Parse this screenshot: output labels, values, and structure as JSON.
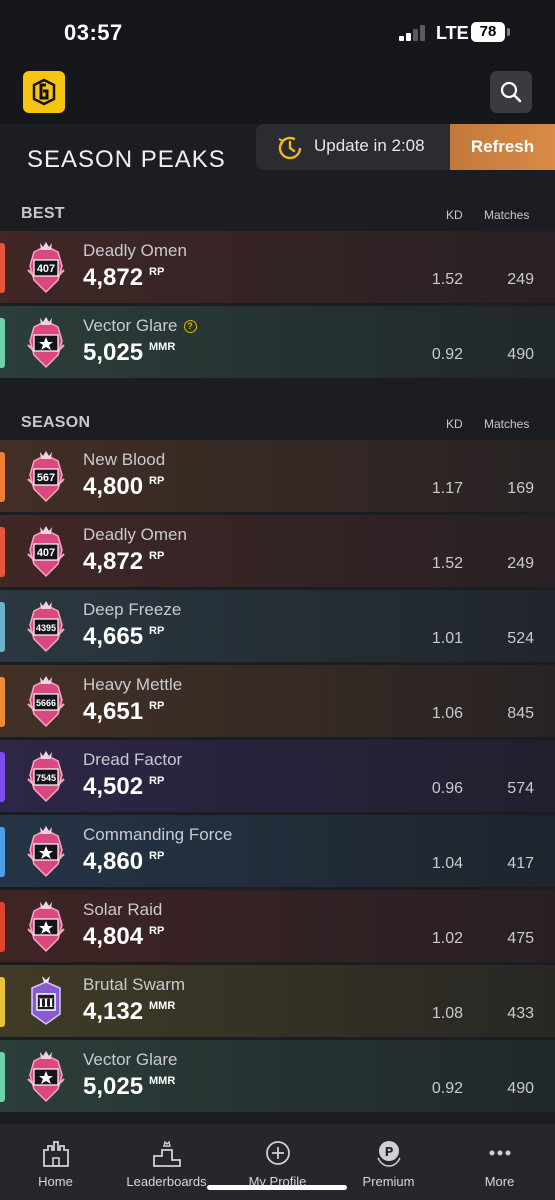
{
  "status_bar": {
    "time": "03:57",
    "network": "LTE",
    "battery": "78"
  },
  "header": {
    "logo_icon": "siege-logo-icon",
    "search_icon": "search-icon"
  },
  "update": {
    "text": "Update in 2:08",
    "refresh_label": "Refresh"
  },
  "page_title": "SEASON PEAKS",
  "columns": {
    "kd": "KD",
    "matches": "Matches"
  },
  "best": {
    "label": "BEST",
    "rows": [
      {
        "name": "Deadly Omen",
        "value": "4,872",
        "unit": "RP",
        "kd": "1.52",
        "matches": "249",
        "badge": "407",
        "accent": "#e8553a",
        "help": false
      },
      {
        "name": "Vector Glare",
        "value": "5,025",
        "unit": "MMR",
        "kd": "0.92",
        "matches": "490",
        "badge": "",
        "accent": "#6fd3a8",
        "help": true
      }
    ]
  },
  "season": {
    "label": "SEASON",
    "rows": [
      {
        "name": "New Blood",
        "value": "4,800",
        "unit": "RP",
        "kd": "1.17",
        "matches": "169",
        "badge": "567",
        "accent": "#ef7d35"
      },
      {
        "name": "Deadly Omen",
        "value": "4,872",
        "unit": "RP",
        "kd": "1.52",
        "matches": "249",
        "badge": "407",
        "accent": "#e8553a"
      },
      {
        "name": "Deep Freeze",
        "value": "4,665",
        "unit": "RP",
        "kd": "1.01",
        "matches": "524",
        "badge": "4395",
        "accent": "#6fb1c9"
      },
      {
        "name": "Heavy Mettle",
        "value": "4,651",
        "unit": "RP",
        "kd": "1.06",
        "matches": "845",
        "badge": "5666",
        "accent": "#f28a3a"
      },
      {
        "name": "Dread Factor",
        "value": "4,502",
        "unit": "RP",
        "kd": "0.96",
        "matches": "574",
        "badge": "7545",
        "accent": "#7b4df0"
      },
      {
        "name": "Commanding Force",
        "value": "4,860",
        "unit": "RP",
        "kd": "1.04",
        "matches": "417",
        "badge": "",
        "accent": "#4d9fe8"
      },
      {
        "name": "Solar Raid",
        "value": "4,804",
        "unit": "RP",
        "kd": "1.02",
        "matches": "475",
        "badge": "",
        "accent": "#e0442f"
      },
      {
        "name": "Brutal Swarm",
        "value": "4,132",
        "unit": "MMR",
        "kd": "1.08",
        "matches": "433",
        "badge": "III",
        "accent": "#e8c43a"
      },
      {
        "name": "Vector Glare",
        "value": "5,025",
        "unit": "MMR",
        "kd": "0.92",
        "matches": "490",
        "badge": "",
        "accent": "#6fd3a8"
      }
    ]
  },
  "nav": [
    {
      "label": "Home",
      "icon": "castle-icon"
    },
    {
      "label": "Leaderboards",
      "icon": "podium-icon"
    },
    {
      "label": "My Profile",
      "icon": "plus-circle-icon"
    },
    {
      "label": "Premium",
      "icon": "premium-badge-icon"
    },
    {
      "label": "More",
      "icon": "more-dots-icon"
    }
  ]
}
